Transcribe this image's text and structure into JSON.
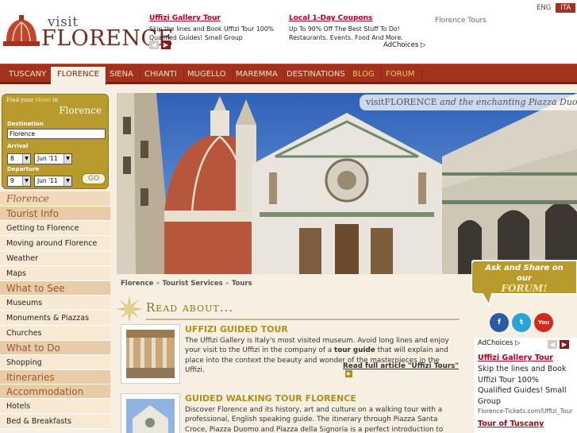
{
  "logo": {
    "visit": "visit",
    "florence": "FLORENCE"
  },
  "header_ads": [
    {
      "title": "Uffizi Gallery Tour",
      "text": "Skip the lines and Book Uffizi Tour 100% Qualified Guides! Small Group"
    },
    {
      "title": "Local 1-Day Coupons",
      "text": "Up To 90% Off The Best Stuff To Do! Restaurants. Events. Food And More."
    }
  ],
  "adchoices": "AdChoices",
  "florence_tours": "Florence Tours",
  "lang": {
    "eng": "ENG",
    "ita": "ITA"
  },
  "nav": [
    "TUSCANY",
    "FLORENCE",
    "SIENA",
    "CHIANTI",
    "MUGELLO",
    "MAREMMA",
    "DESTINATIONS",
    "BLOG",
    "FORUM"
  ],
  "booking": {
    "find": "Find your",
    "hotel": "Hotel",
    "in": "in",
    "city": "Florence",
    "destination_label": "Destination",
    "destination_value": "Florence",
    "arrival_label": "Arrival",
    "arrival_day": "8",
    "arrival_month": "Jun '11",
    "departure_label": "Departure",
    "departure_day": "9",
    "departure_month": "Jun '11",
    "go": "GO"
  },
  "sidebar": {
    "city": "Florence",
    "sections": [
      {
        "head": "Tourist Info",
        "items": [
          "Getting to Florence",
          "Moving around Florence",
          "Weather",
          "Maps"
        ]
      },
      {
        "head": "What to See",
        "items": [
          "Museums",
          "Monuments & Piazzas",
          "Churches"
        ]
      },
      {
        "head": "What to Do",
        "items": [
          "Shopping"
        ]
      },
      {
        "head": "Itineraries",
        "items": []
      },
      {
        "head": "Accommodation",
        "items": [
          "Hotels",
          "Bed & Breakfasts"
        ]
      }
    ]
  },
  "hero": {
    "brand": "visitFLORENCE",
    "caption": "and the enchanting Piazza Duomo"
  },
  "breadcrumb": [
    "Florence",
    "Tourist Services",
    "Tours"
  ],
  "read_about": "Read about...",
  "articles": [
    {
      "title": "UFFIZI GUIDED TOUR",
      "body_a": "The Uffizi Gallery is Italy's most visited museum. Avoid long lines and enjoy your visit to the Uffizi in the company of a ",
      "body_bold": "tour guide",
      "body_b": " that will explain and place into the context the beauty and wonder of the masterpieces in the Uffizi.",
      "more": "Read full article \"Uffizi Tours\""
    },
    {
      "title": "GUIDED WALKING TOUR FLORENCE",
      "body": "Discover Florence and its history, art and culture on a walking tour with a professional, English speaking guide. The itinerary through Piazza Santa Croce, Piazza Duomo and Piazza della Signoria is a perfect introduction to Florence."
    }
  ],
  "forum_box": {
    "line1": "Ask and Share on",
    "line2": "our",
    "line3": "FORUM!"
  },
  "social": [
    "f",
    "t",
    "You Tube"
  ],
  "side_ad": {
    "choices": "AdChoices",
    "title": "Uffizi Gallery Tour",
    "text": "Skip the lines and Book Uffizi Tour 100% Qualified Guides! Small Group",
    "url": "Florence-Tickets.com/Uffizi_Tour",
    "title2": "Tour of Tuscany"
  },
  "colors": {
    "nav_bg": "#a2321e",
    "gold": "#b09016",
    "cream": "#f6efe2",
    "ad_title": "#b0001e"
  }
}
